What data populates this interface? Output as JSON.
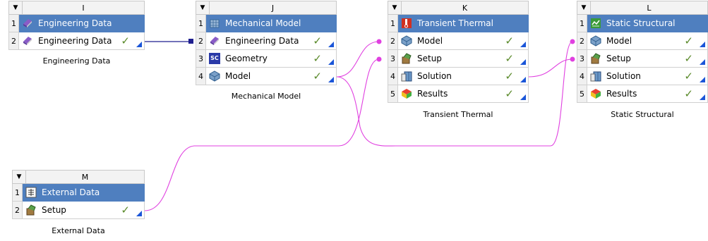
{
  "systems": {
    "I": {
      "letter": "I",
      "caption": "Engineering Data",
      "rows": [
        {
          "num": "1",
          "label": "Engineering Data",
          "icon": "engineering-data-icon"
        },
        {
          "num": "2",
          "label": "Engineering Data",
          "icon": "engineering-data-icon",
          "status": "✓"
        }
      ]
    },
    "J": {
      "letter": "J",
      "caption": "Mechanical Model",
      "rows": [
        {
          "num": "1",
          "label": "Mechanical Model",
          "icon": "mechanical-model-icon"
        },
        {
          "num": "2",
          "label": "Engineering Data",
          "icon": "engineering-data-icon",
          "status": "✓"
        },
        {
          "num": "3",
          "label": "Geometry",
          "icon": "spaceclaim-geometry-icon",
          "icon_text": "SC",
          "status": "✓"
        },
        {
          "num": "4",
          "label": "Model",
          "icon": "model-mesh-icon",
          "status": "✓"
        }
      ]
    },
    "K": {
      "letter": "K",
      "caption": "Transient Thermal",
      "rows": [
        {
          "num": "1",
          "label": "Transient Thermal",
          "icon": "transient-thermal-icon"
        },
        {
          "num": "2",
          "label": "Model",
          "icon": "model-mesh-icon",
          "status": "✓"
        },
        {
          "num": "3",
          "label": "Setup",
          "icon": "setup-icon",
          "status": "✓"
        },
        {
          "num": "4",
          "label": "Solution",
          "icon": "solution-icon",
          "status": "✓"
        },
        {
          "num": "5",
          "label": "Results",
          "icon": "results-icon",
          "status": "✓"
        }
      ]
    },
    "L": {
      "letter": "L",
      "caption": "Static Structural",
      "rows": [
        {
          "num": "1",
          "label": "Static Structural",
          "icon": "static-structural-icon"
        },
        {
          "num": "2",
          "label": "Model",
          "icon": "model-mesh-icon",
          "status": "✓"
        },
        {
          "num": "3",
          "label": "Setup",
          "icon": "setup-icon",
          "status": "✓"
        },
        {
          "num": "4",
          "label": "Solution",
          "icon": "solution-icon",
          "status": "✓"
        },
        {
          "num": "5",
          "label": "Results",
          "icon": "results-icon",
          "status": "✓"
        }
      ]
    },
    "M": {
      "letter": "M",
      "caption": "External Data",
      "rows": [
        {
          "num": "1",
          "label": "External Data",
          "icon": "external-data-icon"
        },
        {
          "num": "2",
          "label": "Setup",
          "icon": "setup-icon",
          "status": "✓"
        }
      ]
    }
  },
  "ui": {
    "collapse_glyph": "▼"
  },
  "colors": {
    "header_row": "#4f7fbf",
    "share_link": "#1f1f8f",
    "transfer_link": "#e040e0",
    "status_check": "#5a8a2a",
    "corner_marker": "#1a55d8"
  }
}
